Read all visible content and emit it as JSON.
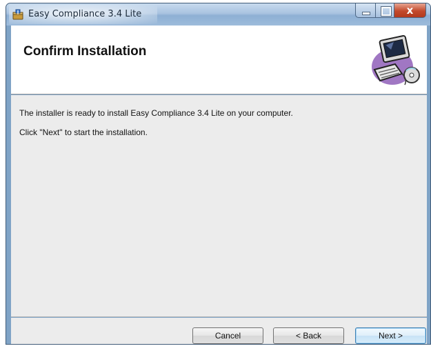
{
  "window": {
    "title": "Easy Compliance 3.4 Lite",
    "close_glyph": "x"
  },
  "header": {
    "title": "Confirm Installation",
    "logo_icon": "computer-cd-icon"
  },
  "content": {
    "line1": "The installer is ready to install Easy Compliance 3.4 Lite on your computer.",
    "line2": "Click \"Next\" to start the installation."
  },
  "buttons": {
    "cancel": "Cancel",
    "back": "< Back",
    "next": "Next >"
  },
  "colors": {
    "title_bar": "#a9c3e0",
    "close_button": "#c24a2c",
    "dialog_body": "#ececec",
    "default_button_border": "#3c7fb1"
  }
}
